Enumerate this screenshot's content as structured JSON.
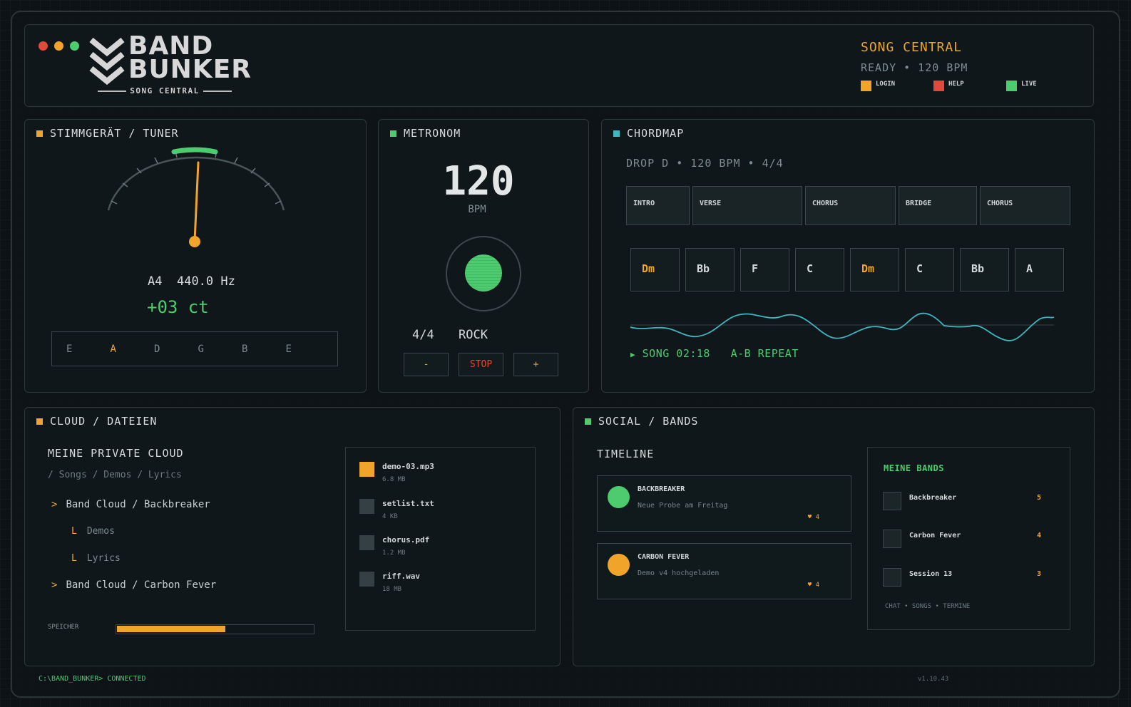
{
  "header": {
    "logo_line1": "BAND",
    "logo_line2": "BUNKER",
    "logo_sub": "SONG CENTRAL",
    "title": "SONG CENTRAL",
    "status": "READY  •  120 BPM",
    "legend": [
      {
        "label": "LOGIN",
        "color": "#f0a52a"
      },
      {
        "label": "HELP",
        "color": "#e04a3a"
      },
      {
        "label": "LIVE",
        "color": "#4ccc6e"
      }
    ],
    "window_dots": [
      "#e04a3a",
      "#f0a52a",
      "#4ccc6e"
    ]
  },
  "tuner": {
    "title": "STIMMGERÄT / TUNER",
    "note": "A4",
    "frequency": "440.0 Hz",
    "cents": "+03 ct",
    "strings": [
      "E",
      "A",
      "D",
      "G",
      "B",
      "E"
    ],
    "active_string": 1
  },
  "metronome": {
    "title": "METRONOM",
    "bpm": "120",
    "bpm_label": "BPM",
    "time_signature": "4/4",
    "style": "ROCK",
    "minus_label": "-",
    "stop_label": "STOP",
    "plus_label": "+"
  },
  "chordmap": {
    "title": "CHORDMAP",
    "info": "DROP D  •  120 BPM  •  4/4",
    "sections": [
      "INTRO",
      "VERSE",
      "CHORUS",
      "BRIDGE",
      "CHORUS"
    ],
    "chords": [
      {
        "name": "Dm",
        "accent": true
      },
      {
        "name": "Bb",
        "accent": false
      },
      {
        "name": "F",
        "accent": false
      },
      {
        "name": "C",
        "accent": false
      },
      {
        "name": "Dm",
        "accent": true
      },
      {
        "name": "C",
        "accent": false
      },
      {
        "name": "Bb",
        "accent": false
      },
      {
        "name": "A",
        "accent": false
      }
    ],
    "play_icon": "▶",
    "position": "SONG 02:18",
    "repeat": "A-B REPEAT"
  },
  "cloud": {
    "title": "CLOUD / DATEIEN",
    "heading": "MEINE PRIVATE CLOUD",
    "path": "/ Songs / Demos / Lyrics",
    "tree": {
      "item1": "Band Cloud / Backbreaker",
      "sub1": "Demos",
      "sub2": "Lyrics",
      "item2": "Band Cloud / Carbon Fever"
    },
    "storage_label": "SPEICHER",
    "storage_used": 0.55,
    "files": [
      {
        "name": "demo-03.mp3",
        "size": "6.8 MB",
        "color": "#f0a52a"
      },
      {
        "name": "setlist.txt",
        "size": "4 KB",
        "color": "#344044"
      },
      {
        "name": "chorus.pdf",
        "size": "1.2 MB",
        "color": "#344044"
      },
      {
        "name": "riff.wav",
        "size": "18 MB",
        "color": "#344044"
      }
    ]
  },
  "social": {
    "title": "SOCIAL / BANDS",
    "timeline_heading": "TIMELINE",
    "posts": [
      {
        "band": "BACKBREAKER",
        "text": "Neue Probe am Freitag",
        "likes": "♥ 4",
        "color": "#4ccc6e"
      },
      {
        "band": "CARBON FEVER",
        "text": "Demo v4 hochgeladen",
        "likes": "♥ 4",
        "color": "#f0a52a"
      }
    ],
    "bands_heading": "MEINE BANDS",
    "bands": [
      {
        "name": "Backbreaker",
        "count": "5"
      },
      {
        "name": "Carbon Fever",
        "count": "4"
      },
      {
        "name": "Session 13",
        "count": "3"
      }
    ],
    "bands_links": "CHAT • SONGS • TERMINE"
  },
  "footer": {
    "prompt": "C:\\BAND_BUNKER> CONNECTED",
    "version": "v1.10.43"
  }
}
